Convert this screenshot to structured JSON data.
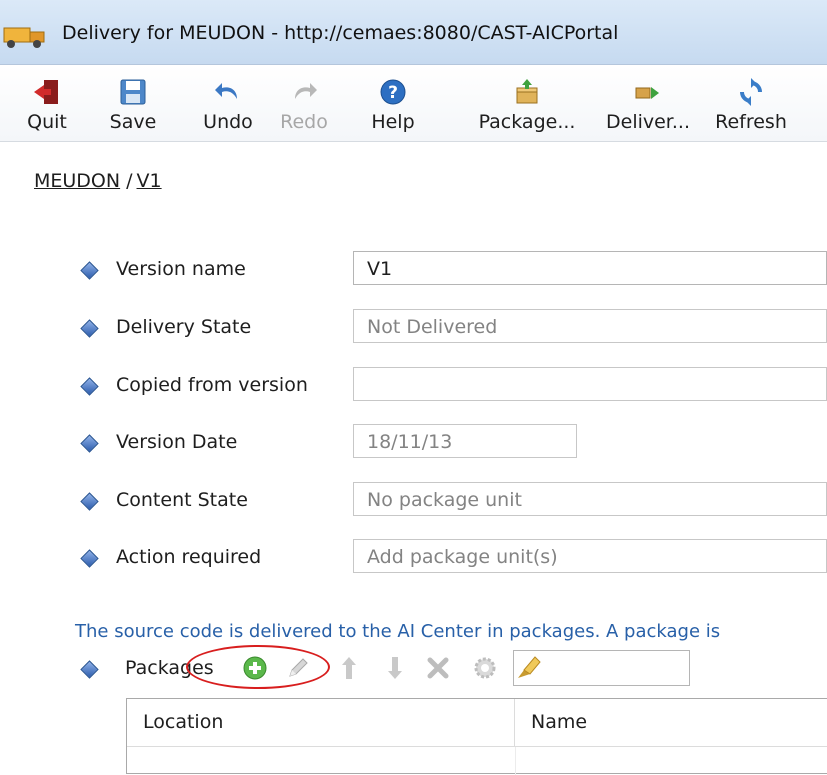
{
  "window": {
    "title": "Delivery for MEUDON - http://cemaes:8080/CAST-AICPortal"
  },
  "toolbar": {
    "items": [
      {
        "label": "Quit",
        "icon": "quit-icon",
        "enabled": true
      },
      {
        "label": "Save",
        "icon": "save-icon",
        "enabled": true
      },
      {
        "label": "Undo",
        "icon": "undo-icon",
        "enabled": true
      },
      {
        "label": "Redo",
        "icon": "redo-icon",
        "enabled": false
      },
      {
        "label": "Help",
        "icon": "help-icon",
        "enabled": true
      },
      {
        "label": "Package...",
        "icon": "package-icon",
        "enabled": true
      },
      {
        "label": "Deliver...",
        "icon": "deliver-icon",
        "enabled": true
      },
      {
        "label": "Refresh",
        "icon": "refresh-icon",
        "enabled": true
      }
    ]
  },
  "breadcrumb": {
    "application": "MEUDON",
    "separator": "/",
    "version": "V1"
  },
  "form": {
    "fields": [
      {
        "label": "Version name",
        "value": "V1",
        "editable": true
      },
      {
        "label": "Delivery State",
        "value": "Not Delivered",
        "editable": false
      },
      {
        "label": "Copied from version",
        "value": "",
        "editable": false
      },
      {
        "label": "Version Date",
        "value": "18/11/13",
        "editable": false
      },
      {
        "label": "Content State",
        "value": "No package unit",
        "editable": false
      },
      {
        "label": "Action required",
        "value": "Add package unit(s)",
        "editable": false
      }
    ]
  },
  "info_text": "The source code is delivered to the AI Center in packages. A package is",
  "packages": {
    "label": "Packages",
    "tools": [
      "add-icon",
      "edit-icon",
      "move-up-icon",
      "move-down-icon",
      "delete-icon",
      "settings-icon",
      "filter-icon"
    ],
    "filter_value": ""
  },
  "table": {
    "columns": [
      "Location",
      "Name"
    ]
  },
  "colors": {
    "title_bar": "#c6daf0",
    "info_text": "#2860a8",
    "highlight": "#d81e1e",
    "accent_diamond": "#2d5dad"
  }
}
